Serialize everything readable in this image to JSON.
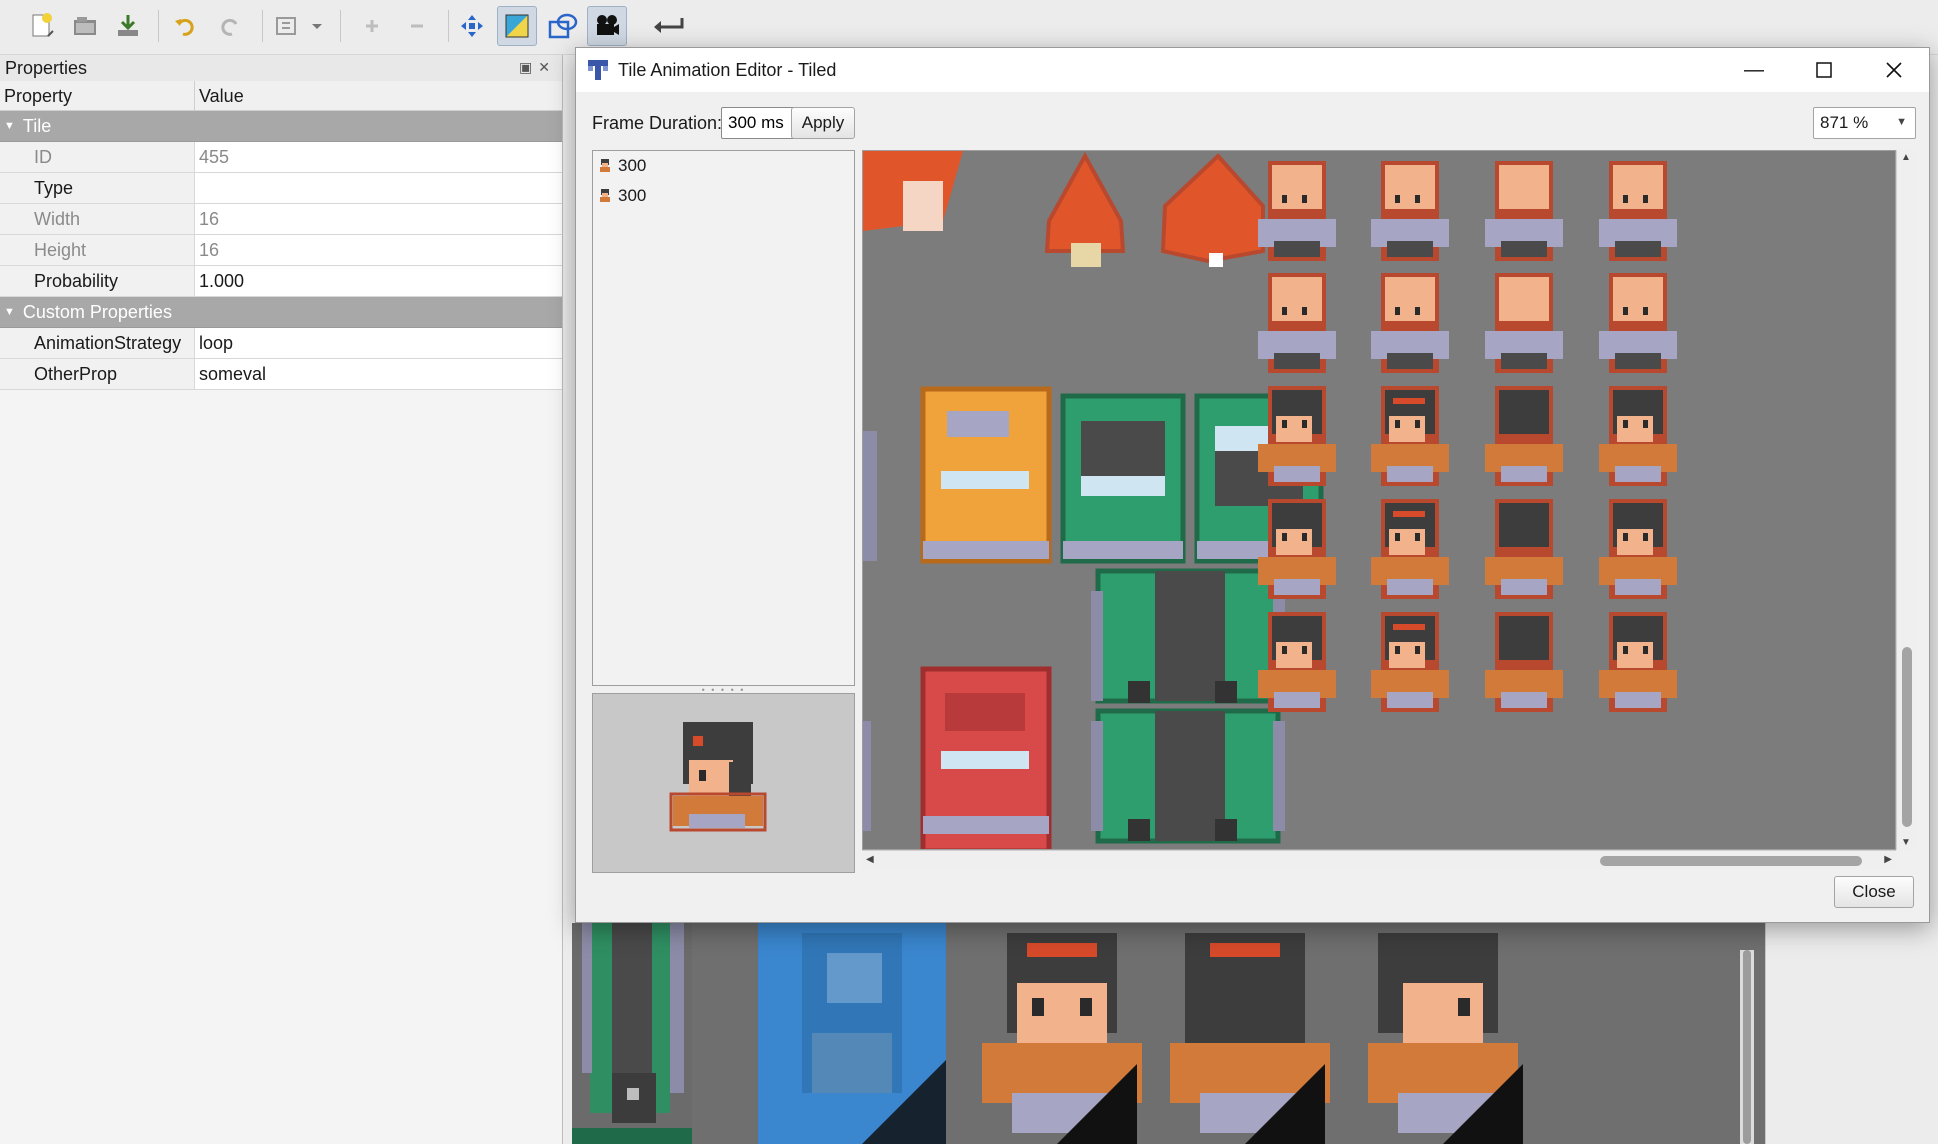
{
  "toolbar": {
    "buttons": [
      {
        "name": "new-icon",
        "active": false
      },
      {
        "name": "open-icon",
        "active": false
      },
      {
        "name": "save-icon",
        "active": false
      },
      {
        "name": "undo-icon",
        "active": false
      },
      {
        "name": "redo-icon",
        "active": false
      },
      {
        "name": "stamp-icon",
        "active": false
      },
      {
        "name": "add-icon",
        "active": false
      },
      {
        "name": "remove-icon",
        "active": false
      },
      {
        "name": "move-icon",
        "active": false
      },
      {
        "name": "terrain-icon",
        "active": true
      },
      {
        "name": "shapes-icon",
        "active": false
      },
      {
        "name": "camera-icon",
        "active": true
      },
      {
        "name": "return-icon",
        "active": false
      }
    ]
  },
  "properties": {
    "panel_title": "Properties",
    "col_property": "Property",
    "col_value": "Value",
    "tile_group": "Tile",
    "custom_group": "Custom Properties",
    "tile_rows": [
      {
        "key": "ID",
        "value": "455",
        "readonly": true
      },
      {
        "key": "Type",
        "value": "",
        "readonly": false
      },
      {
        "key": "Width",
        "value": "16",
        "readonly": true
      },
      {
        "key": "Height",
        "value": "16",
        "readonly": true
      },
      {
        "key": "Probability",
        "value": "1.000",
        "readonly": false
      }
    ],
    "custom_rows": [
      {
        "key": "AnimationStrategy",
        "value": "loop"
      },
      {
        "key": "OtherProp",
        "value": "someval"
      }
    ]
  },
  "dialog": {
    "title": "Tile Animation Editor - Tiled",
    "frame_duration_label": "Frame Duration:",
    "frame_duration_value": "300 ms",
    "apply_label": "Apply",
    "zoom_value": "871 %",
    "close_label": "Close",
    "frames": [
      {
        "duration": "300"
      },
      {
        "duration": "300"
      }
    ]
  },
  "colors": {
    "accent": "#3578c7",
    "tileset_bg": "#7c7c7c",
    "skin": "#f2b28c",
    "hair": "#3d3d3d",
    "outline": "#b8492f",
    "shirt": "#d27a3a",
    "tree": "#e0562a",
    "car_orange": "#f0a33a",
    "car_green": "#2f9e6e",
    "car_red": "#d84a4a"
  }
}
